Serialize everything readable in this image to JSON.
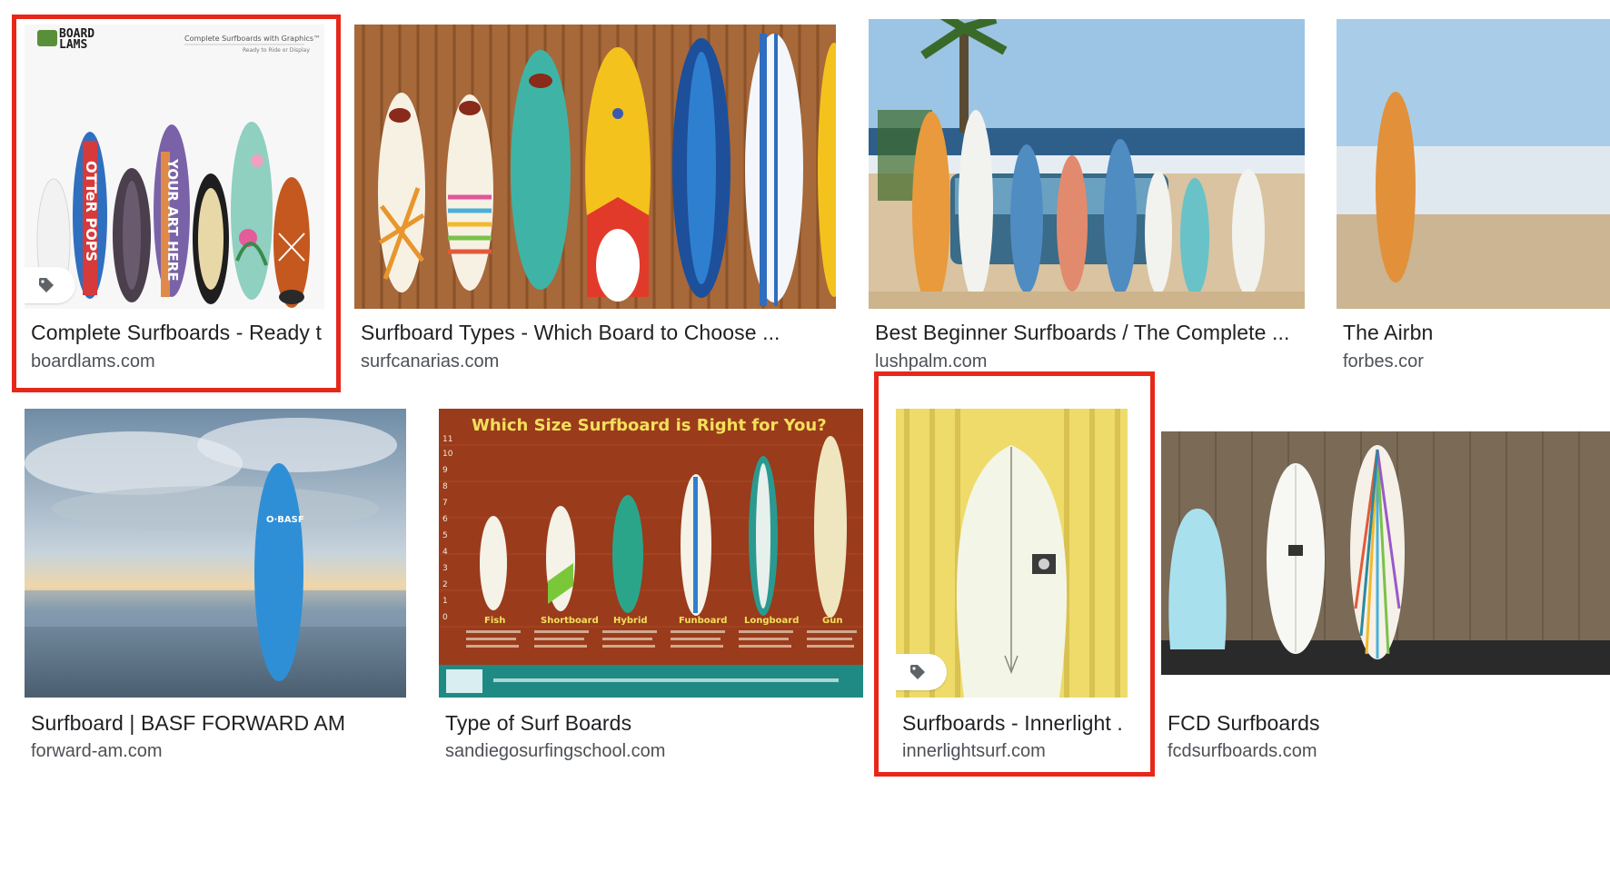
{
  "colors": {
    "highlight": "#e8271b",
    "title_text": "#202124",
    "source_text": "#4d5156"
  },
  "results": [
    {
      "title": "Complete Surfboards - Ready t...",
      "source": "boardlams.com",
      "has_tag": true,
      "highlighted": true,
      "image_text": {
        "logo_top": "BOARD",
        "logo_bottom": "LAMS",
        "header_line1": "Complete Surfboards with Graphics™",
        "header_line2": "Ready to Ride or Display",
        "board_text1": "OTTeR POPS",
        "board_text2": "YOUR ART HERE"
      }
    },
    {
      "title": "Surfboard Types - Which Board to Choose ...",
      "source": "surfcanarias.com",
      "has_tag": false,
      "highlighted": false
    },
    {
      "title": "Best Beginner Surfboards / The Complete ...",
      "source": "lushpalm.com",
      "has_tag": false,
      "highlighted": false
    },
    {
      "title": "The Airbn",
      "source": "forbes.cor",
      "has_tag": false,
      "highlighted": false
    },
    {
      "title": "Surfboard | BASF FORWARD AM",
      "source": "forward-am.com",
      "has_tag": false,
      "highlighted": false,
      "image_text": {
        "board_label": "O·BASF"
      }
    },
    {
      "title": "Type of Surf Boards",
      "source": "sandiegosurfingschool.com",
      "has_tag": false,
      "highlighted": false,
      "image_text": {
        "heading": "Which Size Surfboard is Right for You?",
        "board_names": [
          "Fish",
          "Shortboard",
          "Hybrid",
          "Funboard",
          "Longboard",
          "Gun"
        ],
        "scale": [
          "11",
          "10",
          "9",
          "8",
          "7",
          "6",
          "5",
          "4",
          "3",
          "2",
          "1",
          "0"
        ]
      }
    },
    {
      "title": "Surfboards - Innerlight ...",
      "source": "innerlightsurf.com",
      "has_tag": true,
      "highlighted": true
    },
    {
      "title": "FCD Surfboards",
      "source": "fcdsurfboards.com",
      "has_tag": false,
      "highlighted": false
    }
  ]
}
